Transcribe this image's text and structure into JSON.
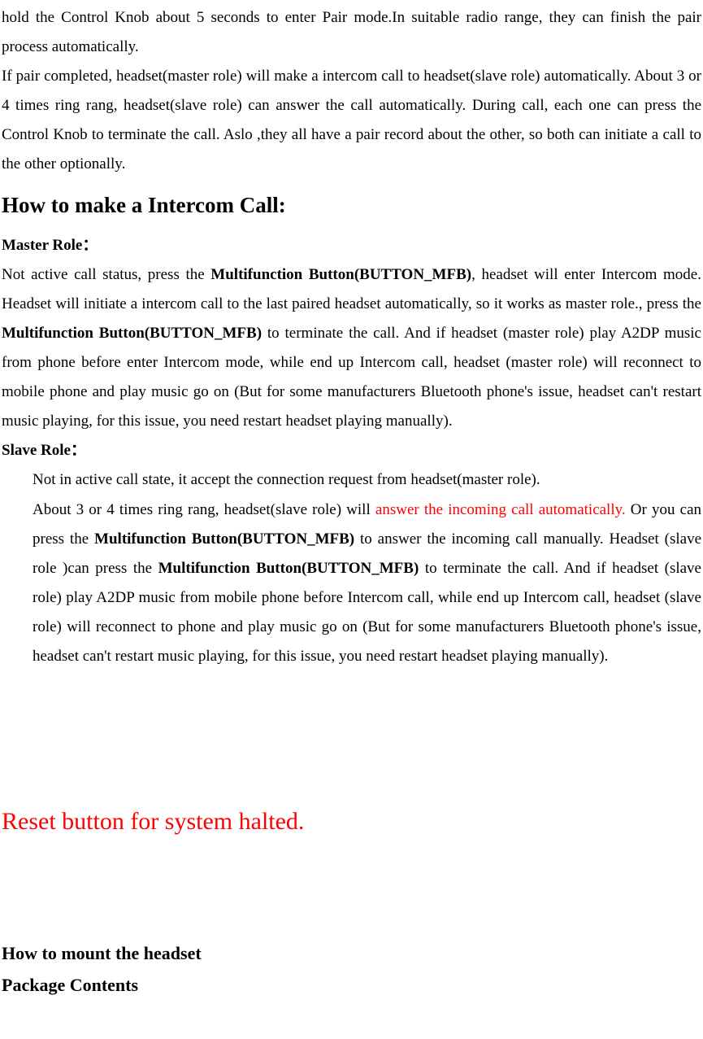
{
  "intro": {
    "p1": "hold the Control Knob about 5 seconds to enter Pair mode.In suitable radio range, they can finish the pair process automatically.",
    "p2_a": "If pair completed, headset(master role) will make a intercom call to headset(slave role) automatically. About 3 or 4 times ring rang, headset(slave role) can answer the call automatically. During call, each one can press the Control Knob to terminate the call. Aslo ,they all have a pair record about the other, so both can initiate a call to the other optionally."
  },
  "intercom": {
    "heading": "How to make a Intercom Call:",
    "master_label": "Master Role：",
    "master_p_a": "Not active call status, press the ",
    "master_p_b": "Multifunction Button(BUTTON_MFB)",
    "master_p_c": ", headset will enter Intercom mode. Headset will initiate a intercom call to the last paired headset automatically, so it works as master role., press the ",
    "master_p_d": "Multifunction Button(BUTTON_MFB)",
    "master_p_e": " to terminate the call. And if headset (master role) play A2DP music from phone before enter Intercom mode, while end up Intercom call, headset (master role) will reconnect to mobile phone and play music go on (But for some manufacturers Bluetooth phone's issue, headset can't restart music playing, for this issue, you need restart headset playing manually).",
    "slave_label": "Slave Role：",
    "slave_p1": "Not in active  call state, it accept the connection request from headset(master role).",
    "slave_p2_a": "About 3 or 4 times ring rang, headset(slave role) will ",
    "slave_p2_red": "answer the incoming call automatically.",
    "slave_p2_b": " Or you can press the ",
    "slave_p2_c": "Multifunction Button(BUTTON_MFB)",
    "slave_p2_d": " to answer the incoming call manually. Headset (slave role )can press the ",
    "slave_p2_e": "Multifunction Button(BUTTON_MFB)",
    "slave_p2_f": " to terminate the call. And if headset (slave role) play A2DP music from mobile phone before Intercom call, while end up Intercom call, headset (slave role) will reconnect to phone and play music go on (But for some manufacturers Bluetooth phone's issue, headset can't restart music playing, for this issue, you need restart headset playing manually)."
  },
  "reset": {
    "heading": "Reset button for system halted."
  },
  "mount": {
    "heading": "How to mount the headset"
  },
  "package": {
    "heading": "Package Contents"
  }
}
